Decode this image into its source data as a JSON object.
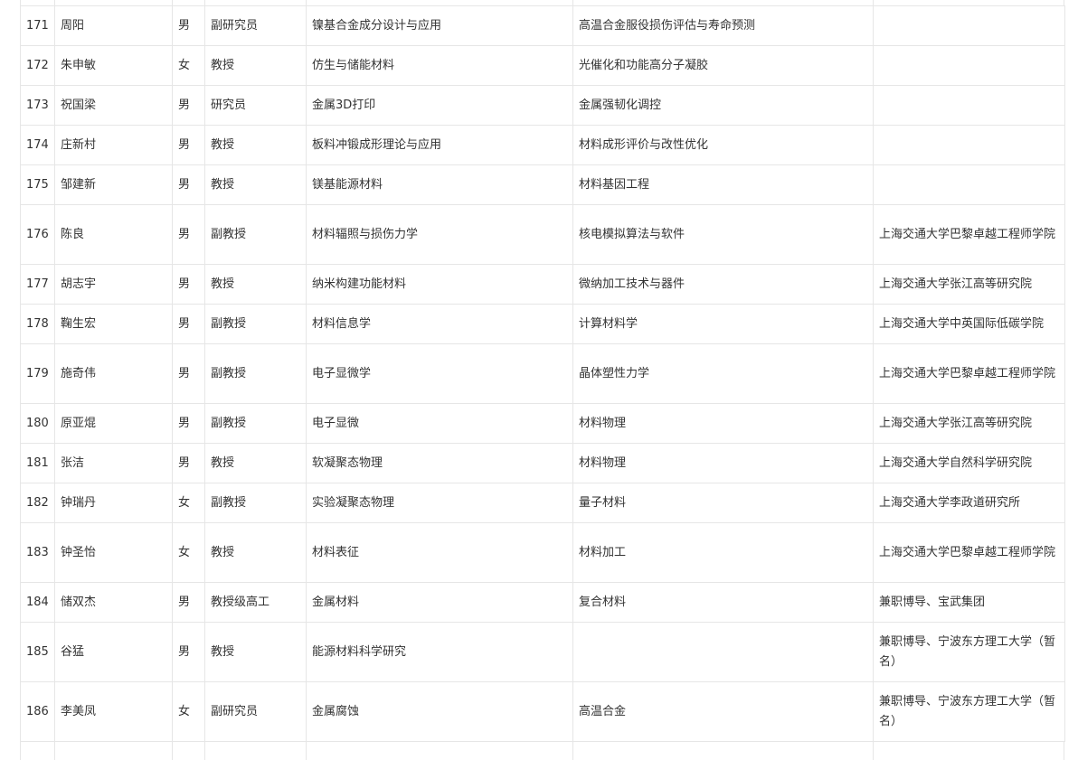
{
  "table": {
    "rows": [
      {
        "no": "171",
        "name": "周阳",
        "gender": "男",
        "title": "副研究员",
        "field1": "镍基合金成分设计与应用",
        "field2": "高温合金服役损伤评估与寿命预测",
        "note": ""
      },
      {
        "no": "172",
        "name": "朱申敏",
        "gender": "女",
        "title": "教授",
        "field1": "仿生与储能材料",
        "field2": "光催化和功能高分子凝胶",
        "note": ""
      },
      {
        "no": "173",
        "name": "祝国梁",
        "gender": "男",
        "title": "研究员",
        "field1": "金属3D打印",
        "field2": "金属强韧化调控",
        "note": ""
      },
      {
        "no": "174",
        "name": "庄新村",
        "gender": "男",
        "title": "教授",
        "field1": "板料冲锻成形理论与应用",
        "field2": "材料成形评价与改性优化",
        "note": ""
      },
      {
        "no": "175",
        "name": "邹建新",
        "gender": "男",
        "title": "教授",
        "field1": "镁基能源材料",
        "field2": "材料基因工程",
        "note": ""
      },
      {
        "no": "176",
        "name": "陈良",
        "gender": "男",
        "title": "副教授",
        "field1": "材料辐照与损伤力学",
        "field2": "核电模拟算法与软件",
        "note": "上海交通大学巴黎卓越工程师学院"
      },
      {
        "no": "177",
        "name": "胡志宇",
        "gender": "男",
        "title": "教授",
        "field1": "纳米构建功能材料",
        "field2": "微纳加工技术与器件",
        "note": "上海交通大学张江高等研究院"
      },
      {
        "no": "178",
        "name": "鞠生宏",
        "gender": "男",
        "title": "副教授",
        "field1": "材料信息学",
        "field2": "计算材料学",
        "note": "上海交通大学中英国际低碳学院"
      },
      {
        "no": "179",
        "name": "施奇伟",
        "gender": "男",
        "title": "副教授",
        "field1": "电子显微学",
        "field2": "晶体塑性力学",
        "note": "上海交通大学巴黎卓越工程师学院"
      },
      {
        "no": "180",
        "name": "原亚焜",
        "gender": "男",
        "title": "副教授",
        "field1": "电子显微",
        "field2": "材料物理",
        "note": "上海交通大学张江高等研究院"
      },
      {
        "no": "181",
        "name": "张洁",
        "gender": "男",
        "title": "教授",
        "field1": "软凝聚态物理",
        "field2": "材料物理",
        "note": "上海交通大学自然科学研究院"
      },
      {
        "no": "182",
        "name": "钟瑞丹",
        "gender": "女",
        "title": "副教授",
        "field1": "实验凝聚态物理",
        "field2": "量子材料",
        "note": "上海交通大学李政道研究所"
      },
      {
        "no": "183",
        "name": "钟圣怡",
        "gender": "女",
        "title": "教授",
        "field1": "材料表征",
        "field2": "材料加工",
        "note": "上海交通大学巴黎卓越工程师学院"
      },
      {
        "no": "184",
        "name": "储双杰",
        "gender": "男",
        "title": "教授级高工",
        "field1": "金属材料",
        "field2": "复合材料",
        "note": "兼职博导、宝武集团"
      },
      {
        "no": "185",
        "name": "谷猛",
        "gender": "男",
        "title": "教授",
        "field1": "能源材料科学研究",
        "field2": "",
        "note": "兼职博导、宁波东方理工大学（暂名）"
      },
      {
        "no": "186",
        "name": "李美凤",
        "gender": "女",
        "title": "副研究员",
        "field1": "金属腐蚀",
        "field2": "高温合金",
        "note": "兼职博导、宁波东方理工大学（暂名）"
      }
    ]
  }
}
